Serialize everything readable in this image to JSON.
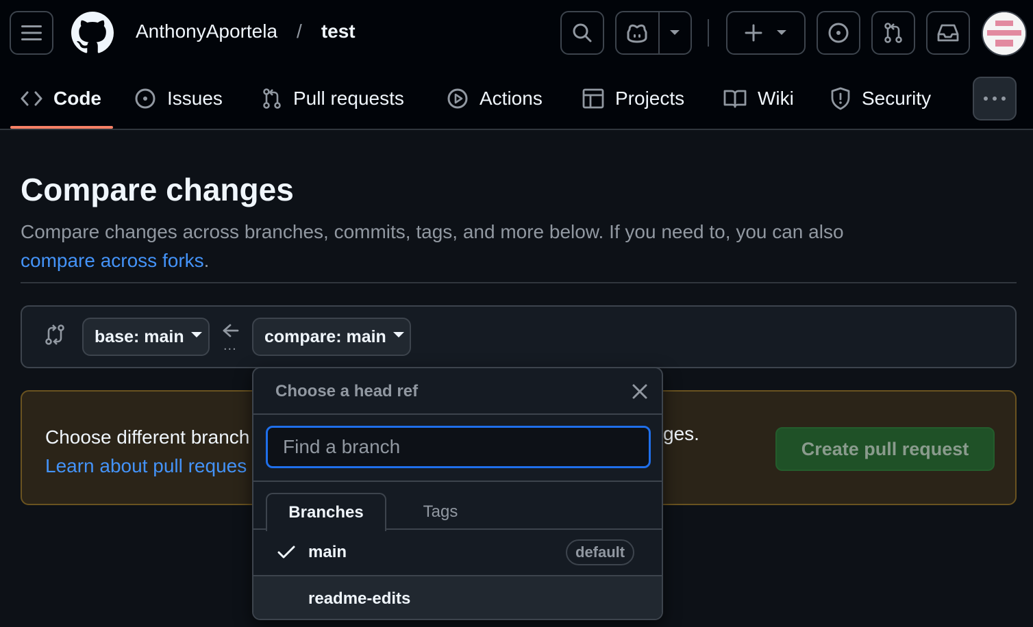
{
  "header": {
    "owner": "AnthonyAportela",
    "separator": "/",
    "repo": "test"
  },
  "nav": {
    "tabs": [
      {
        "label": "Code",
        "icon": "code-icon",
        "active": true
      },
      {
        "label": "Issues",
        "icon": "issue-opened-icon"
      },
      {
        "label": "Pull requests",
        "icon": "git-pull-request-icon"
      },
      {
        "label": "Actions",
        "icon": "play-icon"
      },
      {
        "label": "Projects",
        "icon": "table-icon"
      },
      {
        "label": "Wiki",
        "icon": "book-icon"
      },
      {
        "label": "Security",
        "icon": "shield-icon"
      }
    ]
  },
  "main": {
    "title": "Compare changes",
    "subtitle": "Compare changes across branches, commits, tags, and more below. If you need to, you can also",
    "subtitle_link": "compare across forks",
    "subtitle_end": ".",
    "base_label": "base: main",
    "compare_label": "compare: main",
    "range_dots": "...",
    "notice_text": "Choose different branch",
    "notice_tail": "ges.",
    "notice_link": "Learn about pull reques",
    "create_button": "Create pull request"
  },
  "dropdown": {
    "title": "Choose a head ref",
    "search_placeholder": "Find a branch",
    "tabs": [
      "Branches",
      "Tags"
    ],
    "branches": [
      {
        "name": "main",
        "selected": true,
        "badge": "default"
      },
      {
        "name": "readme-edits",
        "selected": false
      }
    ]
  },
  "colors": {
    "accent": "#1f6feb",
    "link": "#4493f8",
    "tab_underline": "#f78166",
    "create_button": "#1f5127"
  }
}
